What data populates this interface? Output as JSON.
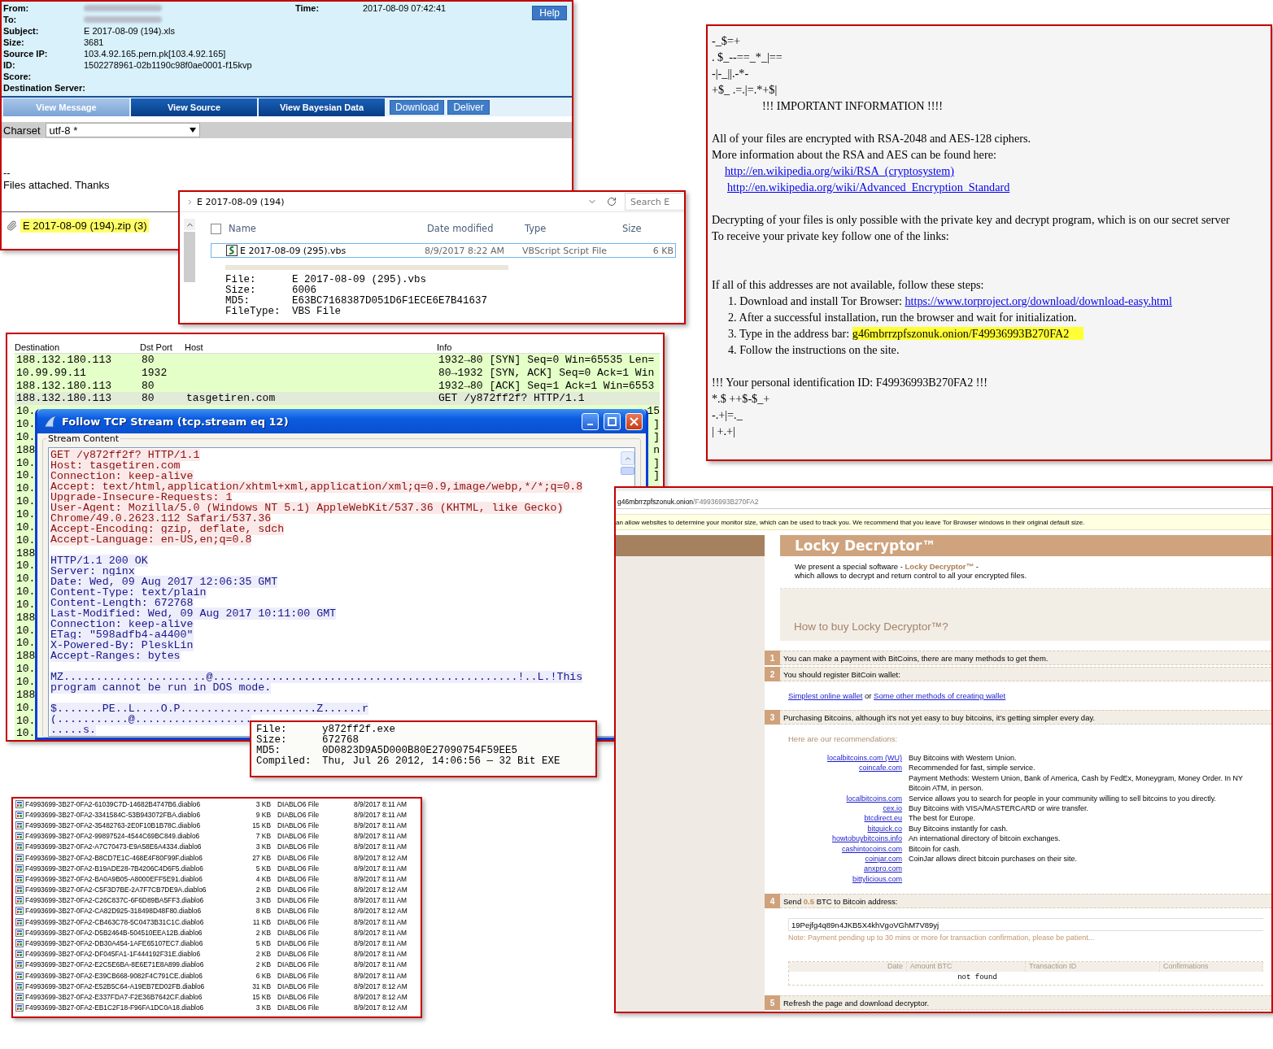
{
  "email": {
    "fields": [
      {
        "label": "From:",
        "kind": "redacted"
      },
      {
        "label": "To:",
        "kind": "redacted"
      },
      {
        "label": "Subject:",
        "kind": "text",
        "value": "E 2017-08-09 (194).xls"
      },
      {
        "label": "Size:",
        "kind": "text",
        "value": "3681"
      },
      {
        "label": "Source IP:",
        "kind": "text",
        "value": "103.4.92.165.pern.pk[103.4.92.165]"
      },
      {
        "label": "ID:",
        "kind": "text",
        "value": "1502278961-02b1190c98f0ae0001-f15kvp"
      },
      {
        "label": "Score:",
        "kind": "text"
      },
      {
        "label": "Destination Server:",
        "kind": "text"
      }
    ],
    "time": {
      "label": "Time:",
      "value": "2017-08-09 07:42:41"
    },
    "help_button": "Help",
    "tabs": [
      {
        "label": "View Message",
        "selected": true
      },
      {
        "label": "View Source",
        "selected": false
      },
      {
        "label": "View Bayesian Data",
        "selected": false
      }
    ],
    "buttons": [
      "Download",
      "Deliver"
    ],
    "charset": {
      "label": "Charset",
      "value": "utf-8 *"
    },
    "body": [
      "--",
      "Files attached. Thanks"
    ],
    "attachment": "E 2017-08-09 (194).zip (3)"
  },
  "explorer": {
    "breadcrumb": "E 2017-08-09 (194)",
    "search": {
      "placeholder": "Search E"
    },
    "select_all": {
      "checked": false
    },
    "columns": [
      "Name",
      "Date modified",
      "Type",
      "Size"
    ],
    "rows": [
      {
        "name": "E 2017-08-09 (295).vbs",
        "date": "8/9/2017 8:22 AM",
        "type": "VBScript Script File",
        "size": "6 KB",
        "selected": true
      }
    ],
    "info": [
      {
        "label": "File:",
        "value": "E 2017-08-09 (295).vbs"
      },
      {
        "label": "Size:",
        "value": "6006"
      },
      {
        "label": "MD5:",
        "value": "E63BC7168387D051D6F1ECE6E7B41637"
      },
      {
        "label": "FileType:",
        "value": "VBS File"
      }
    ]
  },
  "wireshark": {
    "columns": [
      "Destination",
      "Dst Port",
      "Host",
      "Info"
    ],
    "rows": [
      {
        "destination": "188.132.180.113",
        "port": "80",
        "info": "1932→80 [SYN] Seq=0 Win=65535 Len=",
        "color": "#e4ffc7"
      },
      {
        "destination": "10.99.99.11",
        "port": "1932",
        "info": "80→1932 [SYN, ACK] Seq=0 Ack=1 Win",
        "color": "#e4ffc7"
      },
      {
        "destination": "188.132.180.113",
        "port": "80",
        "info": "1932→80 [ACK] Seq=1 Ack=1 Win=6553",
        "color": "#e4ffc7"
      },
      {
        "destination": "188.132.180.113",
        "port": "80",
        "host": "tasgetiren.com",
        "info": "GET /y872ff2f? HTTP/1.1",
        "color": "#e2ead8"
      },
      {
        "destination": "10.",
        "info_end": "15",
        "color": "#e4ffc7"
      },
      {
        "destination": "10.",
        "info_end": "]",
        "color": "#e4ffc7"
      },
      {
        "destination": "10.",
        "info_end": "]",
        "color": "#e4ffc7"
      },
      {
        "destination": "188",
        "info_end": "n",
        "color": "#e4ffc7"
      },
      {
        "destination": "10.",
        "info_end": "]",
        "color": "#e4ffc7"
      },
      {
        "destination": "10.",
        "info_end": "]",
        "color": "#e4ffc7"
      },
      {
        "destination": "10.",
        "color": "#e4ffc7"
      },
      {
        "destination": "10.",
        "color": "#e4ffc7"
      },
      {
        "destination": "10.",
        "color": "#e4ffc7"
      },
      {
        "destination": "10.",
        "color": "#e4ffc7"
      },
      {
        "destination": "10.",
        "color": "#e4ffc7"
      },
      {
        "destination": "188",
        "color": "#e4ffc7"
      },
      {
        "destination": "10.",
        "color": "#e4ffc7"
      },
      {
        "destination": "10.",
        "color": "#e4ffc7"
      },
      {
        "destination": "10.",
        "color": "#e4ffc7"
      },
      {
        "destination": "10.",
        "color": "#e4ffc7"
      },
      {
        "destination": "188",
        "color": "#e4ffc7"
      },
      {
        "destination": "10.",
        "color": "#e4ffc7"
      },
      {
        "destination": "10.",
        "color": "#e4ffc7"
      },
      {
        "destination": "188",
        "color": "#e4ffc7"
      },
      {
        "destination": "10.",
        "color": "#e4ffc7"
      },
      {
        "destination": "10.",
        "color": "#e4ffc7"
      },
      {
        "destination": "188",
        "color": "#e4ffc7"
      },
      {
        "destination": "10.",
        "color": "#e4ffc7"
      },
      {
        "destination": "10.",
        "color": "#e4ffc7"
      },
      {
        "destination": "10.",
        "color": "#e4ffc7"
      }
    ]
  },
  "tcp_stream": {
    "title": "Follow TCP Stream (tcp.stream eq 12)",
    "group": "Stream Content",
    "lines": [
      {
        "kind": "request",
        "text": "GET /y872ff2f? HTTP/1.1"
      },
      {
        "kind": "request",
        "text": "Host: tasgetiren.com"
      },
      {
        "kind": "request",
        "text": "Connection: keep-alive"
      },
      {
        "kind": "request",
        "text": "Accept: text/html,application/xhtml+xml,application/xml;q=0.9,image/webp,*/*;q=0.8"
      },
      {
        "kind": "request",
        "text": "Upgrade-Insecure-Requests: 1"
      },
      {
        "kind": "request",
        "text": "User-Agent: Mozilla/5.0 (Windows NT 5.1) AppleWebKit/537.36 (KHTML, like Gecko)"
      },
      {
        "kind": "request",
        "text": "Chrome/49.0.2623.112 Safari/537.36"
      },
      {
        "kind": "request",
        "text": "Accept-Encoding: gzip, deflate, sdch"
      },
      {
        "kind": "request",
        "text": "Accept-Language: en-US,en;q=0.8"
      },
      {
        "kind": "blank"
      },
      {
        "kind": "response",
        "text": "HTTP/1.1 200 OK"
      },
      {
        "kind": "response",
        "text": "Server: nginx"
      },
      {
        "kind": "response",
        "text": "Date: Wed, 09 Aug 2017 12:06:35 GMT"
      },
      {
        "kind": "response",
        "text": "Content-Type: text/plain"
      },
      {
        "kind": "response",
        "text": "Content-Length: 672768"
      },
      {
        "kind": "response",
        "text": "Last-Modified: Wed, 09 Aug 2017 10:11:00 GMT"
      },
      {
        "kind": "response",
        "text": "Connection: keep-alive"
      },
      {
        "kind": "response",
        "text": "ETag: \"598adfb4-a4400\""
      },
      {
        "kind": "response",
        "text": "X-Powered-By: PleskLin"
      },
      {
        "kind": "response",
        "text": "Accept-Ranges: bytes"
      },
      {
        "kind": "blank"
      },
      {
        "kind": "response",
        "text": "MZ......................@...............................................!..L.!This"
      },
      {
        "kind": "response",
        "text": "program cannot be run in DOS mode."
      },
      {
        "kind": "blank"
      },
      {
        "kind": "response",
        "text": "$.......PE..L....O.P.....................Z......r"
      },
      {
        "kind": "response",
        "text": "(...........@.................."
      },
      {
        "kind": "response",
        "text": ".....s."
      }
    ]
  },
  "payload_info": [
    {
      "label": "File:",
      "value": "y872ff2f.exe"
    },
    {
      "label": "Size:",
      "value": "672768"
    },
    {
      "label": "MD5:",
      "value": "0D0823D9A5D000B80E27090754F59EE5"
    },
    {
      "label": "Compiled:",
      "value": "Thu, Jul 26 2012, 14:06:56 — 32 Bit EXE"
    }
  ],
  "encrypted_files": [
    {
      "name": "F4993699-3B27-0FA2-61039C7D-14682B4747B6.diablo6",
      "size": "3 KB",
      "type": "DIABLO6 File",
      "date": "8/9/2017 8:11 AM"
    },
    {
      "name": "F4993699-3B27-0FA2-3341584C-53B943072FBA.diablo6",
      "size": "9 KB",
      "type": "DIABLO6 File",
      "date": "8/9/2017 8:11 AM"
    },
    {
      "name": "F4993699-3B27-0FA2-35482763-2E0F10B1B78C.diablo6",
      "size": "15 KB",
      "type": "DIABLO6 File",
      "date": "8/9/2017 8:11 AM"
    },
    {
      "name": "F4993699-3B27-0FA2-99897524-4544C69BC849.diablo6",
      "size": "7 KB",
      "type": "DIABLO6 File",
      "date": "8/9/2017 8:11 AM"
    },
    {
      "name": "F4993699-3B27-0FA2-A7C70473-E9A58E6A4334.diablo6",
      "size": "3 KB",
      "type": "DIABLO6 File",
      "date": "8/9/2017 8:11 AM"
    },
    {
      "name": "F4993699-3B27-0FA2-B8CD7E1C-468E4F80F99F.diablo6",
      "size": "27 KB",
      "type": "DIABLO6 File",
      "date": "8/9/2017 8:12 AM"
    },
    {
      "name": "F4993699-3B27-0FA2-B19ADE28-7B4206C4D6F5.diablo6",
      "size": "5 KB",
      "type": "DIABLO6 File",
      "date": "8/9/2017 8:11 AM"
    },
    {
      "name": "F4993699-3B27-0FA2-BA0A9B05-A8000EFF5E91.diablo6",
      "size": "4 KB",
      "type": "DIABLO6 File",
      "date": "8/9/2017 8:11 AM"
    },
    {
      "name": "F4993699-3B27-0FA2-C5F3D7BE-2A7F7CB7DE9A.diablo6",
      "size": "2 KB",
      "type": "DIABLO6 File",
      "date": "8/9/2017 8:12 AM"
    },
    {
      "name": "F4993699-3B27-0FA2-C26C837C-6F6D89BA5FF3.diablo6",
      "size": "3 KB",
      "type": "DIABLO6 File",
      "date": "8/9/2017 8:11 AM"
    },
    {
      "name": "F4993699-3B27-0FA2-CA82D925-318498D48F80.diablo6",
      "size": "8 KB",
      "type": "DIABLO6 File",
      "date": "8/9/2017 8:12 AM"
    },
    {
      "name": "F4993699-3B27-0FA2-CB463C78-5C0473B31C1C.diablo6",
      "size": "11 KB",
      "type": "DIABLO6 File",
      "date": "8/9/2017 8:11 AM"
    },
    {
      "name": "F4993699-3B27-0FA2-D5B2464B-504510EEA12B.diablo6",
      "size": "2 KB",
      "type": "DIABLO6 File",
      "date": "8/9/2017 8:11 AM"
    },
    {
      "name": "F4993699-3B27-0FA2-DB30A454-1AFE65107EC7.diablo6",
      "size": "5 KB",
      "type": "DIABLO6 File",
      "date": "8/9/2017 8:11 AM"
    },
    {
      "name": "F4993699-3B27-0FA2-DF045FA1-1F444192F31E.diablo6",
      "size": "2 KB",
      "type": "DIABLO6 File",
      "date": "8/9/2017 8:11 AM"
    },
    {
      "name": "F4993699-3B27-0FA2-E2C5E6BA-8E6E71E8A899.diablo6",
      "size": "2 KB",
      "type": "DIABLO6 File",
      "date": "8/9/2017 8:11 AM"
    },
    {
      "name": "F4993699-3B27-0FA2-E39CB668-9082F4C791CE.diablo6",
      "size": "6 KB",
      "type": "DIABLO6 File",
      "date": "8/9/2017 8:11 AM"
    },
    {
      "name": "F4993699-3B27-0FA2-E52B5C64-A19EB7ED02FB.diablo6",
      "size": "31 KB",
      "type": "DIABLO6 File",
      "date": "8/9/2017 8:12 AM"
    },
    {
      "name": "F4993699-3B27-0FA2-E337FDA7-F2E36B7642CF.diablo6",
      "size": "15 KB",
      "type": "DIABLO6 File",
      "date": "8/9/2017 8:12 AM"
    },
    {
      "name": "F4993699-3B27-0FA2-EB1C2F18-F96FA1DC0A18.diablo6",
      "size": "3 KB",
      "type": "DIABLO6 File",
      "date": "8/9/2017 8:12 AM"
    }
  ],
  "ransom_note": [
    {
      "kind": "text",
      "text": "-_$=+"
    },
    {
      "kind": "text",
      "text": ". $_--==_*_|=="
    },
    {
      "kind": "text",
      "text": "-|-_||.-*-"
    },
    {
      "kind": "text",
      "text": "+$_ .=.|=.*+$|"
    },
    {
      "kind": "title",
      "text": "!!! IMPORTANT INFORMATION !!!!"
    },
    {
      "kind": "blank"
    },
    {
      "kind": "text",
      "text": "All of your files are encrypted with RSA-2048 and AES-128 ciphers."
    },
    {
      "kind": "text",
      "text": "More information about the RSA and AES can be found here:"
    },
    {
      "kind": "link",
      "text": "http://en.wikipedia.org/wiki/RSA_(cryptosystem)"
    },
    {
      "kind": "link",
      "text": "http://en.wikipedia.org/wiki/Advanced_Encryption_Standard"
    },
    {
      "kind": "blank"
    },
    {
      "kind": "text",
      "text": "Decrypting of your files is only possible with the private key and decrypt program, which is on our secret server"
    },
    {
      "kind": "text",
      "text": "To receive your private key follow one of the links:"
    },
    {
      "kind": "blank"
    },
    {
      "kind": "blank"
    },
    {
      "kind": "text",
      "text": "If all of this addresses are not available, follow these steps:"
    },
    {
      "kind": "step",
      "number": "1.",
      "text": "Download and install Tor Browser: ",
      "link": "https://www.torproject.org/download/download-easy.html"
    },
    {
      "kind": "step",
      "number": "2.",
      "text": "After a successful installation, run the browser and wait for initialization."
    },
    {
      "kind": "step",
      "number": "3.",
      "text": "Type in the address bar: ",
      "highlight": "g46mbrrzpfszonuk.onion/F49936993B270FA2"
    },
    {
      "kind": "step",
      "number": "4.",
      "text": "Follow the instructions on the site."
    },
    {
      "kind": "blank"
    },
    {
      "kind": "text",
      "text": "!!! Your personal identification ID: F49936993B270FA2 !!!"
    },
    {
      "kind": "text",
      "text": "*.$ ++$-$_+"
    },
    {
      "kind": "text",
      "text": " -.+|=._"
    },
    {
      "kind": "text",
      "text": "| +.+|"
    }
  ],
  "locky": {
    "address_host": "g46mbrrzpfszonuk.onion",
    "address_path": "/F49936993B270FA2",
    "notice": "an allow websites to determine your monitor size, which can be used to track you. We recommend that you leave Tor Browser windows in their original default size.",
    "title": "Locky Decryptor™",
    "intro_before": "We present a special software - ",
    "intro_brand": "Locky Decryptor™",
    "intro_after": " -",
    "intro_line2": "which allows to decrypt and return control to all your encrypted files.",
    "heading": "How to buy Locky Decryptor™?",
    "steps": [
      {
        "number": "1",
        "text": "You can make a payment with BitCoins, there are many methods to get them."
      },
      {
        "number": "2",
        "text": "You should register BitCoin wallet:",
        "body": {
          "kind": "links",
          "links": [
            "Simplest online wallet",
            "Some other methods of creating wallet"
          ],
          "joiner": " or "
        }
      },
      {
        "number": "3",
        "text": "Purchasing Bitcoins, although it's not yet easy to buy bitcoins, it's getting simpler every day.",
        "body": {
          "kind": "exchanges",
          "label": "Here are our recommendations:",
          "items": [
            {
              "link": "localbitcoins.com (WU)",
              "lines": [
                "Buy Bitcoins with Western Union."
              ]
            },
            {
              "link": "coincafe.com",
              "lines": [
                "Recommended for fast, simple service.",
                "Payment Methods: Western Union, Bank of America, Cash by FedEx, Moneygram, Money Order. In NY",
                "Bitcoin ATM, in person."
              ]
            },
            {
              "link": "localbitcoins.com",
              "lines": [
                "Service allows you to search for people in your community willing to sell bitcoins to you directly."
              ]
            },
            {
              "link": "cex.io",
              "lines": [
                "Buy Bitcoins with VISA/MASTERCARD or wire transfer."
              ]
            },
            {
              "link": "btcdirect.eu",
              "lines": [
                "The best for Europe."
              ]
            },
            {
              "link": "bitquick.co",
              "lines": [
                "Buy Bitcoins instantly for cash."
              ]
            },
            {
              "link": "howtobuybitcoins.info",
              "lines": [
                "An international directory of bitcoin exchanges."
              ]
            },
            {
              "link": "cashintocoins.com",
              "lines": [
                "Bitcoin for cash."
              ]
            },
            {
              "link": "coinjar.com",
              "lines": [
                "CoinJar allows direct bitcoin purchases on their site."
              ]
            },
            {
              "link": "anxpro.com"
            },
            {
              "link": "bittylicious.com"
            }
          ]
        }
      },
      {
        "number": "4",
        "text": "Send ",
        "amount": "0.5",
        "text_after": " BTC to Bitcoin address:",
        "body": {
          "kind": "payment",
          "address": "19Pejfg4q89n4JKB5X4khVgoVGhM7V89yj",
          "note": "Note: Payment pending up to 30 mins or more for transaction confirmation, please be patient...",
          "columns": [
            "Date",
            "Amount BTC",
            "Transaction ID",
            "Confirmations"
          ],
          "empty": "not found"
        }
      },
      {
        "number": "5",
        "text": "Refresh the page and download decryptor."
      }
    ]
  }
}
